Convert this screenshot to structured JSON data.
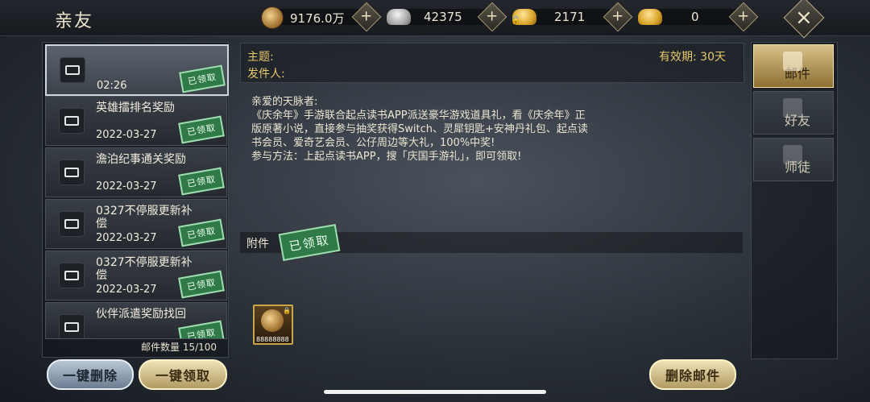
{
  "header": {
    "title": "亲友",
    "resources": [
      {
        "icon": "copper-coin-icon",
        "value": "9176.0万"
      },
      {
        "icon": "silver-ingot-icon",
        "value": "42375"
      },
      {
        "icon": "bound-gold-ingot-icon",
        "value": "2171"
      },
      {
        "icon": "gold-ingot-icon",
        "value": "0"
      }
    ]
  },
  "mail_list": {
    "items": [
      {
        "title": "",
        "date": "02:26",
        "status": "已领取",
        "selected": true
      },
      {
        "title": "英雄擂排名奖励",
        "date": "2022-03-27",
        "status": "已领取"
      },
      {
        "title": "澹泊纪事通关奖励",
        "date": "2022-03-27",
        "status": "已领取"
      },
      {
        "title": "0327不停服更新补偿",
        "date": "2022-03-27",
        "status": "已领取"
      },
      {
        "title": "0327不停服更新补偿",
        "date": "2022-03-27",
        "status": "已领取"
      },
      {
        "title": "伙伴派遣奖励找回",
        "date": "",
        "status": "已领取"
      }
    ],
    "count_label": "邮件数量 15/100",
    "delete_all_label": "一键删除",
    "claim_all_label": "一键领取"
  },
  "mail_detail": {
    "subject_label": "主题:",
    "sender_label": "发件人:",
    "validity": "有效期: 30天",
    "body_lines": [
      "亲爱的天脉者:",
      "《庆余年》手游联合起点读书APP派送豪华游戏道具礼，看《庆余年》正",
      "版原著小说，直接参与抽奖获得Switch、灵犀钥匙+安神丹礼包、起点读",
      "书会员、爱奇艺会员、公仔周边等大礼，100%中奖!",
      "参与方法：上起点读书APP，搜「庆国手游礼」，即可领取!"
    ],
    "attachment_label": "附件",
    "attachment_status": "已领取",
    "attachment_item": {
      "icon": "copper-coin-icon",
      "quantity": "88888888"
    },
    "delete_label": "删除邮件"
  },
  "tabs": [
    {
      "label": "邮件",
      "icon": "mail-scroll-icon",
      "active": true
    },
    {
      "label": "好友",
      "icon": "friend-icon",
      "active": false
    },
    {
      "label": "师徒",
      "icon": "mentor-icon",
      "active": false
    }
  ]
}
